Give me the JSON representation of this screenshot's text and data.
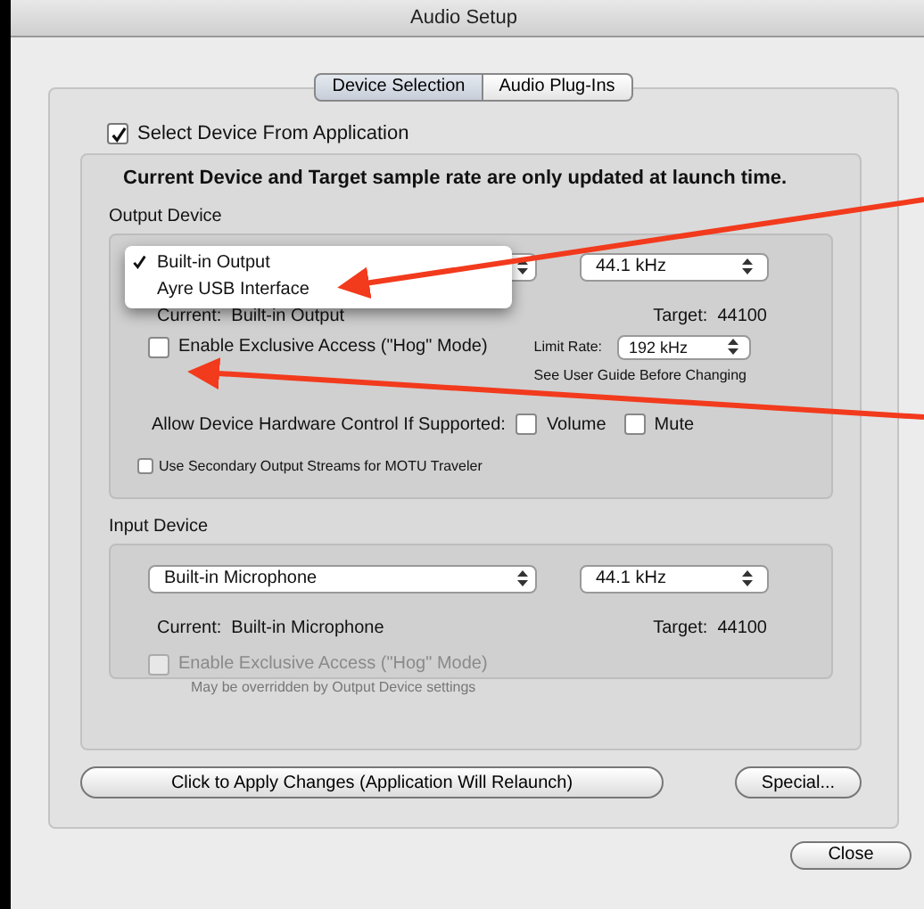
{
  "window": {
    "title": "Audio Setup"
  },
  "tabs": [
    {
      "label": "Device Selection",
      "selected": true
    },
    {
      "label": "Audio Plug-Ins",
      "selected": false
    }
  ],
  "select_from_app": {
    "label": "Select Device From Application",
    "checked": true
  },
  "notice": "Current Device and Target sample rate are only updated at launch time.",
  "output": {
    "heading": "Output Device",
    "menu": [
      {
        "label": "Built-in Output",
        "selected": true
      },
      {
        "label": "Ayre USB Interface",
        "selected": false
      }
    ],
    "rate": "44.1 kHz",
    "current": "Current:  Built-in Output",
    "target": "Target:  44100",
    "hog": {
      "label": "Enable Exclusive Access (\"Hog\" Mode)",
      "checked": false,
      "disabled": false
    },
    "limit_label": "Limit Rate:",
    "limit_value": "192 kHz",
    "limit_note": "See User Guide Before Changing",
    "hw_label": "Allow Device Hardware Control If Supported:",
    "hw_options": [
      {
        "label": "Volume",
        "checked": false
      },
      {
        "label": "Mute",
        "checked": false
      }
    ],
    "secondary": {
      "label": "Use Secondary Output Streams for MOTU Traveler",
      "checked": false
    }
  },
  "input": {
    "heading": "Input Device",
    "device": "Built-in Microphone",
    "rate": "44.1 kHz",
    "current": "Current:  Built-in Microphone",
    "target": "Target:  44100",
    "hog": {
      "label": "Enable Exclusive Access (\"Hog\" Mode)",
      "checked": false,
      "disabled": true
    },
    "hog_note": "May be overridden by Output Device settings"
  },
  "buttons": [
    {
      "label": "Click to Apply Changes (Application Will Relaunch)"
    },
    {
      "label": "Special..."
    }
  ],
  "close_button": "Close"
}
